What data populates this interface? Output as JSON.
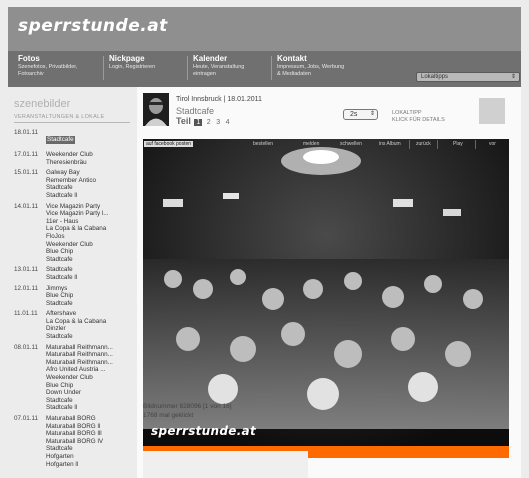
{
  "header": {
    "logo": "sperrstunde.at"
  },
  "nav": [
    {
      "title": "Fotos",
      "sub": "Szenefotos, Privatbilder,\nFotoarchiv"
    },
    {
      "title": "Nickpage",
      "sub": "Login, Registrieren"
    },
    {
      "title": "Kalender",
      "sub": "Heute, Veranstaltung\neintragen"
    },
    {
      "title": "Kontakt",
      "sub": "Impressum, Jobs, Werbung\n& Mediadaten"
    }
  ],
  "lokaltipps": {
    "value": "Lokaltipps"
  },
  "sidebar": {
    "title": "szenebilder",
    "subtitle": "VERANSTALTUNGEN & LOKALE",
    "groups": [
      {
        "date": "18.01.11",
        "items": [
          "Stadtcafe"
        ]
      },
      {
        "date": "17.01.11",
        "items": [
          "Weekender Club",
          "Theresienbräu"
        ]
      },
      {
        "date": "15.01.11",
        "items": [
          "Galway Bay",
          "Remember Antico",
          "Stadtcafe",
          "Stadtcafe ll"
        ]
      },
      {
        "date": "14.01.11",
        "items": [
          "Vice Magazin Party",
          "Vice Magazin Party l...",
          "11er - Haus",
          "La Copa & la Cabana",
          "FloJos",
          "Weekender Club",
          "Blue Chip",
          "Stadtcafe"
        ]
      },
      {
        "date": "13.01.11",
        "items": [
          "Stadtcafe",
          "Stadtcafe ll"
        ]
      },
      {
        "date": "12.01.11",
        "items": [
          "Jimmys",
          "Blue Chip",
          "Stadtcafe"
        ]
      },
      {
        "date": "11.01.11",
        "items": [
          "Aftershave",
          "La Copa & la Cabana",
          "Dinzler",
          "Stadtcafe"
        ]
      },
      {
        "date": "08.01.11",
        "items": [
          "Maturaball Reithmann...",
          "Maturaball Reithmann...",
          "Maturaball Reithmann...",
          "Afro United Austria ...",
          "Weekender Club",
          "Blue Chip",
          "Down Under",
          "Stadtcafe",
          "Stadtcafe ll"
        ]
      },
      {
        "date": "07.01.11",
        "items": [
          "Maturaball BORG",
          "Maturaball BORG ll",
          "Maturaball BORG lll",
          "Maturaball BORG lV",
          "Stadtcafe",
          "Hofgarten",
          "Hofgarten ll"
        ]
      }
    ]
  },
  "album": {
    "location_date": "Tirol Innsbruck | 18.01.2011",
    "venue": "Stadtcafe",
    "teil_label": "Teil",
    "pages": [
      "1",
      "2",
      "3",
      "4"
    ],
    "speed": "2s",
    "tip_line1": "LOKALTIPP",
    "tip_line2": "KLICK FÜR DETAILS"
  },
  "photo": {
    "toolbar": {
      "facebook": "auf facebook posten",
      "bestellen": "bestellen",
      "melden": "melden",
      "schwellen": "schwellen",
      "album": "ins Album",
      "zurueck": "zurück",
      "play": "Play",
      "vor": "vor"
    },
    "watermark": "sperrstunde.at"
  },
  "info": {
    "bildnummer": "Bildnummer 828096  [1 von 16]",
    "geklickt": "1768 mal geklickt"
  },
  "colors": {
    "accent": "#ff6a00",
    "header": "#8f8f8f",
    "nav": "#707070"
  }
}
